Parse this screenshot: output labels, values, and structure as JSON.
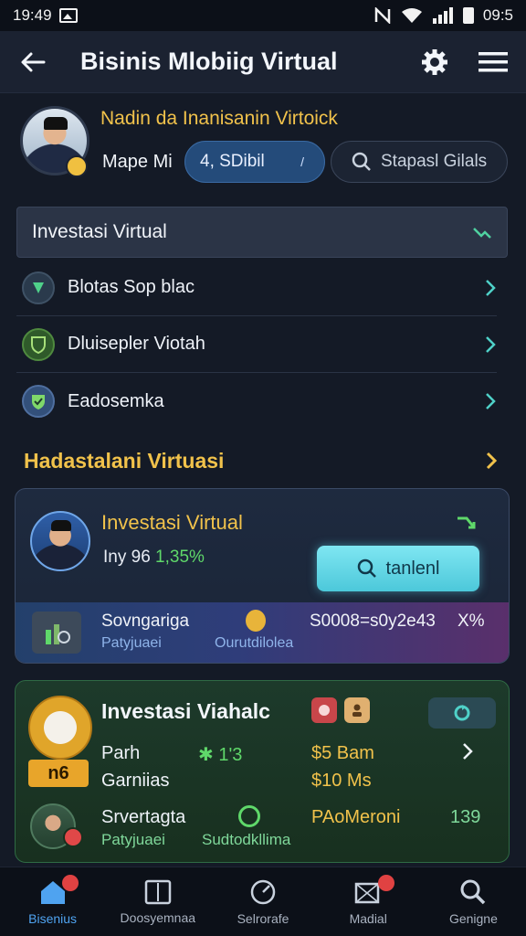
{
  "status_bar": {
    "time": "19:49",
    "right_time": "09:5"
  },
  "app_bar": {
    "title": "Bisinis Mlobiig Virtual",
    "back_icon": "back-arrow-icon",
    "settings_icon": "gear-icon",
    "menu_icon": "hamburger-menu-icon"
  },
  "profile": {
    "headline": "Nadin da Inanisanin Virtoick",
    "name": "Mape Mi",
    "pill_value": "4, SDibil",
    "search_placeholder": "Stapasl Gilals"
  },
  "section": {
    "title": "Investasi Virtual",
    "items": [
      {
        "label": "Blotas Sop blac",
        "icon": "leaf-icon",
        "icon_color": "#1f7a4a"
      },
      {
        "label": "Dluisepler Viotah",
        "icon": "shield-icon",
        "icon_color": "#2f7a2a"
      },
      {
        "label": "Eadosemka",
        "icon": "shield-check-icon",
        "icon_color": "#2f5a9a"
      }
    ]
  },
  "subheading": "Hadastalani Virtuasi",
  "card1": {
    "title": "Investasi Virtual",
    "line_prefix": "Iny 96",
    "line_value": "1,35%",
    "button_label": "tanlenl",
    "band": {
      "t1": "Sovngariga",
      "s1": "Patyjuaei",
      "s2": "Ourutdilolea",
      "t3": "S0008=s0y2e43",
      "t4": "X%"
    }
  },
  "card2": {
    "badge_text": "n6",
    "title": "Investasi Viahalc",
    "row1_label": "Parh",
    "row2_label": "Garniias",
    "row1_green": "1'3",
    "row1_yellow": "$5 Bam",
    "row2_yellow": "$10 Ms",
    "bottom_t1": "Srvertagta",
    "bottom_s1": "Patyjuaei",
    "bottom_s2": "Sudtodkllima",
    "bottom_t3": "PAoMeroni",
    "bottom_t4": "139"
  },
  "bottom_nav": [
    {
      "label": "Bisenius",
      "icon": "home-icon",
      "active": true
    },
    {
      "label": "Doosyemnaa",
      "icon": "book-icon",
      "active": false
    },
    {
      "label": "Selrorafe",
      "icon": "gauge-icon",
      "active": false
    },
    {
      "label": "Madial",
      "icon": "media-icon",
      "active": false
    },
    {
      "label": "Genigne",
      "icon": "search-icon",
      "active": false
    }
  ],
  "colors": {
    "accent_gold": "#f1c24b",
    "accent_green": "#5fd86a",
    "accent_cyan": "#4cc8da",
    "bg": "#141a26"
  }
}
